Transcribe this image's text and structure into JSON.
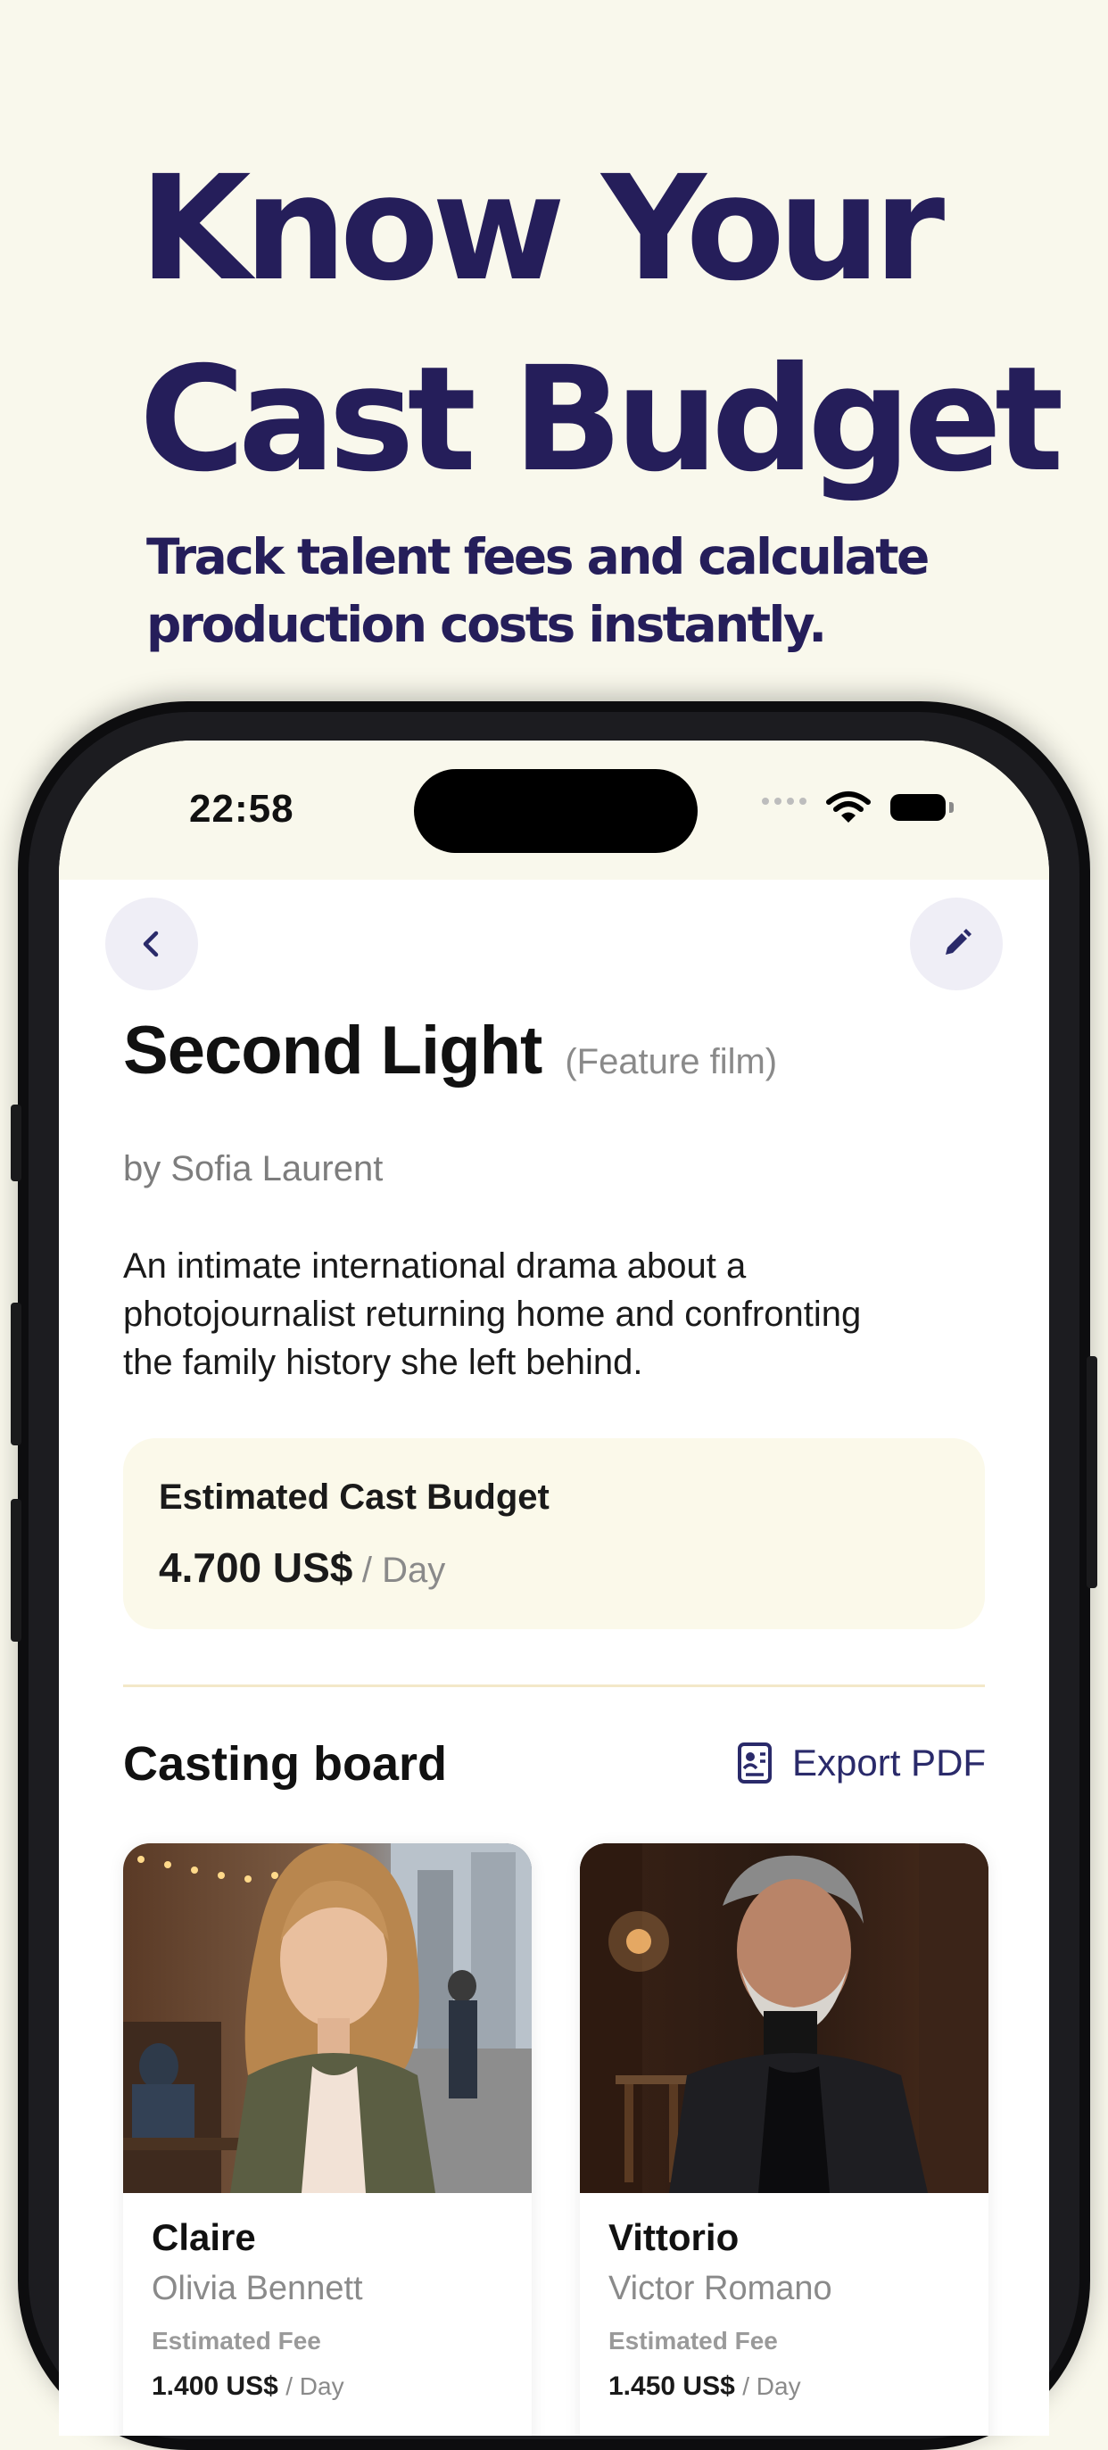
{
  "marketing": {
    "headline_line1": "Know Your",
    "headline_line2": "Cast Budget",
    "subhead_line1": "Track talent fees and calculate",
    "subhead_line2": "production costs instantly."
  },
  "status_bar": {
    "time": "22:58"
  },
  "project": {
    "title": "Second Light",
    "type": "(Feature film)",
    "byline": "by Sofia Laurent",
    "description_lines": [
      "An intimate international drama about a",
      "photojournalist returning home and confronting",
      "the family history she left behind."
    ]
  },
  "budget": {
    "label": "Estimated Cast Budget",
    "value": "4.700 US$",
    "unit": "/ Day"
  },
  "casting_board": {
    "title": "Casting board",
    "export_label": "Export PDF",
    "cards": [
      {
        "role": "Claire",
        "actor": "Olivia Bennett",
        "fee_label": "Estimated Fee",
        "fee_value": "1.400 US$",
        "fee_unit": "/ Day"
      },
      {
        "role": "Vittorio",
        "actor": "Victor Romano",
        "fee_label": "Estimated Fee",
        "fee_value": "1.450 US$",
        "fee_unit": "/ Day"
      }
    ]
  },
  "icons": {
    "back": "chevron-left-icon",
    "edit": "pencil-icon",
    "export": "document-icon"
  },
  "colors": {
    "background": "#f9f8ec",
    "headline": "#251e5a",
    "accent": "#2a2a6a",
    "budget_card": "#fbf9ea"
  }
}
